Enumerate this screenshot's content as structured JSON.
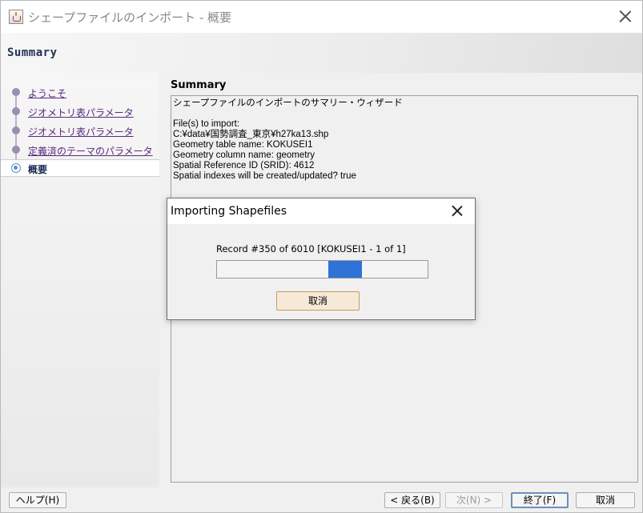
{
  "window": {
    "title": "シェープファイルのインポート - 概要",
    "header_title": "Summary"
  },
  "nav": {
    "items": [
      {
        "label": "ようこそ",
        "current": false
      },
      {
        "label": "ジオメトリ表パラメータ",
        "current": false
      },
      {
        "label": "ジオメトリ表パラメータ",
        "current": false
      },
      {
        "label": "定義済のテーマのパラメータ",
        "current": false
      },
      {
        "label": "概要",
        "current": true
      }
    ]
  },
  "main": {
    "heading": "Summary",
    "lines": [
      "シェープファイルのインポートのサマリー・ウィザード",
      "",
      "File(s) to import:",
      "C:¥data¥国勢調査_東京¥h27ka13.shp",
      "Geometry table name: KOKUSEI1",
      "Geometry column name: geometry",
      "Spatial Reference ID (SRID): 4612",
      "Spatial indexes will be created/updated? true"
    ]
  },
  "buttons": {
    "help": "ヘルプ(H)",
    "back": "< 戻る(B)",
    "next": "次(N) >",
    "finish": "終了(F)",
    "cancel": "取消"
  },
  "dialog": {
    "title": "Importing Shapefiles",
    "record_text": "Record #350 of 6010 [KOKUSEI1 - 1 of 1]",
    "cancel_label": "取消",
    "progress_indicator": {
      "start_fraction": 0.53,
      "end_fraction": 0.69
    },
    "progress_color": "#2f73d6"
  }
}
